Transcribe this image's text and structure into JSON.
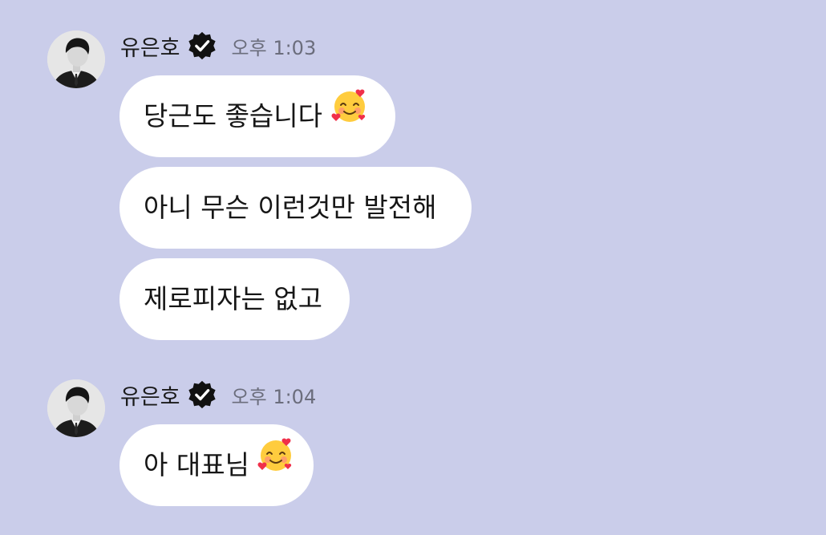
{
  "messages": [
    {
      "sender": "유은호",
      "time": "오후 1:03",
      "avatar_icon": "profile-photo",
      "verified_icon": "verified-badge-icon",
      "bubbles": [
        {
          "text": "당근도 좋습니다",
          "emoji": "smiling-face-with-hearts"
        },
        {
          "text": "아니 무슨 이런것만 발전해"
        },
        {
          "text": "제로피자는 없고"
        }
      ]
    },
    {
      "sender": "유은호",
      "time": "오후 1:04",
      "avatar_icon": "profile-photo",
      "verified_icon": "verified-badge-icon",
      "bubbles": [
        {
          "text": "아 대표님",
          "emoji": "smiling-face-with-hearts"
        }
      ]
    }
  ],
  "colors": {
    "background": "#cacdea",
    "bubble": "#ffffff",
    "timestamp": "#6b6d7c",
    "badge": "#111111"
  }
}
